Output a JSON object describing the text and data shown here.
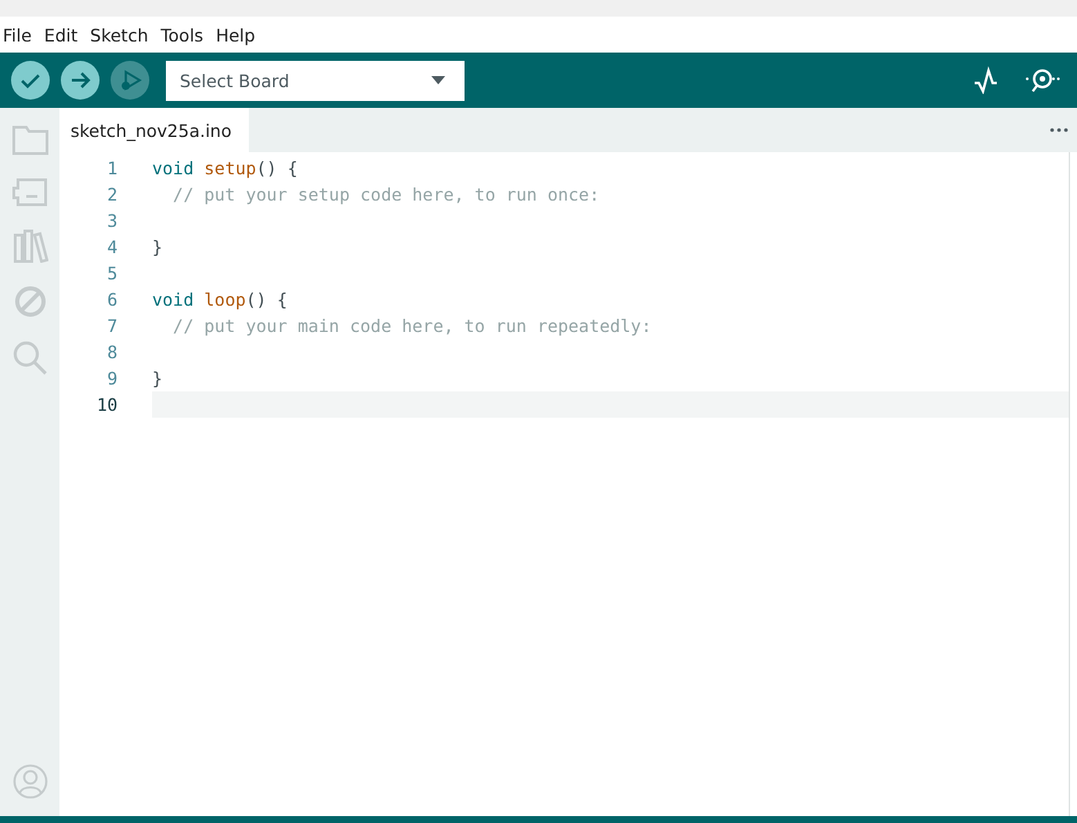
{
  "menu": [
    "File",
    "Edit",
    "Sketch",
    "Tools",
    "Help"
  ],
  "toolbar": {
    "buttons": [
      {
        "kind": "verify",
        "disabled": false
      },
      {
        "kind": "upload",
        "disabled": false
      },
      {
        "kind": "debug",
        "disabled": true
      }
    ],
    "board_select": {
      "value": "Select Board"
    }
  },
  "tabs": [
    {
      "label": "sketch_nov25a.ino",
      "selected": true
    }
  ],
  "sidebar": [
    {
      "kind": "folder"
    },
    {
      "kind": "board"
    },
    {
      "kind": "library"
    },
    {
      "kind": "debug"
    },
    {
      "kind": "search"
    }
  ],
  "editor": {
    "lines": [
      {
        "number": "1",
        "selected": false,
        "tokens": [
          {
            "t": "void setup",
            "kind": "keyword_function"
          },
          {
            "t": "() {",
            "kind": "punct"
          }
        ]
      },
      {
        "number": "2",
        "selected": false,
        "tokens": [
          {
            "t": "  // put your setup code here, to run once:",
            "kind": "comment"
          }
        ]
      },
      {
        "number": "3",
        "selected": false
      },
      {
        "number": "4",
        "selected": false,
        "tokens": [
          {
            "t": "}",
            "kind": "punct"
          }
        ]
      },
      {
        "number": "5",
        "selected": false
      },
      {
        "number": "6",
        "selected": false,
        "tokens": [
          {
            "t": "void loop",
            "kind": "keyword_function"
          },
          {
            "t": "() {",
            "kind": "punct"
          }
        ]
      },
      {
        "number": "7",
        "selected": false,
        "tokens": [
          {
            "t": "  // put your main code here, to run repeatedly:",
            "kind": "comment"
          }
        ]
      },
      {
        "number": "8",
        "selected": false
      },
      {
        "number": "9",
        "selected": false,
        "tokens": [
          {
            "t": "}",
            "kind": "punct"
          }
        ]
      },
      {
        "number": "10",
        "selected": true
      }
    ]
  }
}
